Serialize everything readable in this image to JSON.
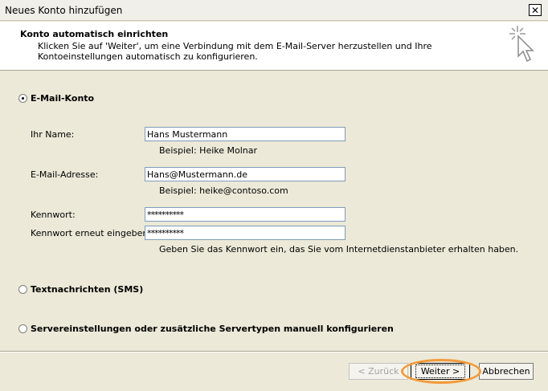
{
  "window": {
    "title": "Neues Konto hinzufügen",
    "close_label": "✕"
  },
  "header": {
    "title": "Konto automatisch einrichten",
    "description": "Klicken Sie auf 'Weiter', um eine Verbindung mit dem E-Mail-Server herzustellen und Ihre Kontoeinstellungen automatisch zu konfigurieren.",
    "icon": "cursor-sparkle-icon"
  },
  "options": {
    "email_account": {
      "label": "E-Mail-Konto",
      "selected": true
    },
    "sms": {
      "label": "Textnachrichten (SMS)",
      "selected": false
    },
    "manual": {
      "label": "Servereinstellungen oder zusätzliche Servertypen manuell konfigurieren",
      "selected": false
    }
  },
  "form": {
    "name": {
      "label": "Ihr Name:",
      "value": "Hans Mustermann",
      "hint": "Beispiel: Heike Molnar"
    },
    "email": {
      "label": "E-Mail-Adresse:",
      "value": "Hans@Mustermann.de",
      "hint": "Beispiel: heike@contoso.com"
    },
    "password": {
      "label": "Kennwort:",
      "value": "**********"
    },
    "password_repeat": {
      "label": "Kennwort erneut eingeben:",
      "value": "**********"
    },
    "password_hint": "Geben Sie das Kennwort ein, das Sie vom Internetdienstanbieter erhalten haben."
  },
  "buttons": {
    "back": "< Zurück",
    "next": "Weiter >",
    "cancel": "Abbrechen"
  },
  "colors": {
    "highlight": "#f39a3c"
  }
}
